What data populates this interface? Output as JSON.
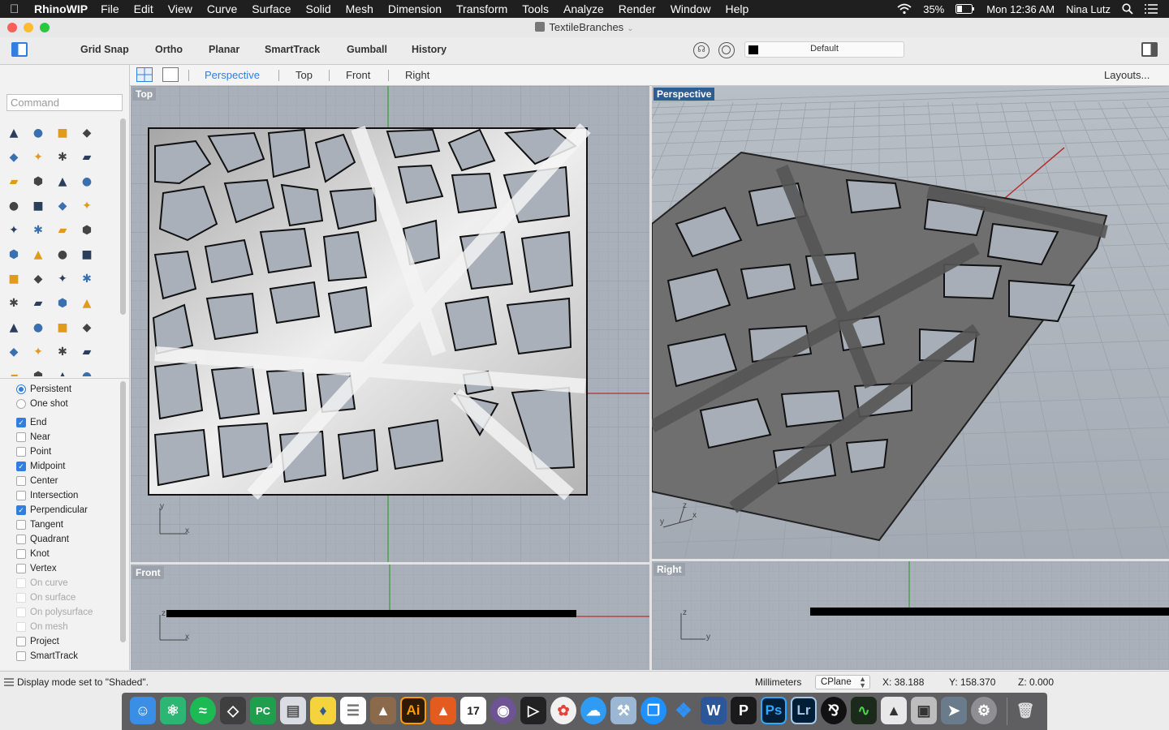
{
  "menubar": {
    "app_name": "RhinoWIP",
    "items": [
      "File",
      "Edit",
      "View",
      "Curve",
      "Surface",
      "Solid",
      "Mesh",
      "Dimension",
      "Transform",
      "Tools",
      "Analyze",
      "Render",
      "Window",
      "Help"
    ],
    "battery": "35%",
    "clock": "Mon 12:36 AM",
    "user": "Nina Lutz"
  },
  "window": {
    "title": "TextileBranches"
  },
  "toolbar": {
    "grid_snap": "Grid Snap",
    "ortho": "Ortho",
    "planar": "Planar",
    "smarttrack": "SmartTrack",
    "gumball": "Gumball",
    "history": "History",
    "layer": "Default"
  },
  "viewport_tabs": {
    "perspective": "Perspective",
    "top": "Top",
    "front": "Front",
    "right": "Right",
    "layouts": "Layouts..."
  },
  "command": {
    "placeholder": "Command"
  },
  "osnap": {
    "persistent": "Persistent",
    "one_shot": "One shot",
    "items": [
      {
        "label": "End",
        "checked": true
      },
      {
        "label": "Near",
        "checked": false
      },
      {
        "label": "Point",
        "checked": false
      },
      {
        "label": "Midpoint",
        "checked": true
      },
      {
        "label": "Center",
        "checked": false
      },
      {
        "label": "Intersection",
        "checked": false
      },
      {
        "label": "Perpendicular",
        "checked": true
      },
      {
        "label": "Tangent",
        "checked": false
      },
      {
        "label": "Quadrant",
        "checked": false
      },
      {
        "label": "Knot",
        "checked": false
      },
      {
        "label": "Vertex",
        "checked": false
      },
      {
        "label": "On curve",
        "checked": false,
        "disabled": true
      },
      {
        "label": "On surface",
        "checked": false,
        "disabled": true
      },
      {
        "label": "On polysurface",
        "checked": false,
        "disabled": true
      },
      {
        "label": "On mesh",
        "checked": false,
        "disabled": true
      },
      {
        "label": "Project",
        "checked": false
      },
      {
        "label": "SmartTrack",
        "checked": false
      }
    ]
  },
  "viewports": {
    "top": "Top",
    "perspective": "Perspective",
    "front": "Front",
    "right": "Right"
  },
  "axes": {
    "x": "x",
    "y": "y",
    "z": "z"
  },
  "status": {
    "message": "Display mode set to \"Shaded\".",
    "units": "Millimeters",
    "cplane": "CPlane",
    "x": "X: 38.188",
    "y": "Y: 158.370",
    "z": "Z: 0.000"
  },
  "dock": {
    "illustrator": "Ai",
    "photoshop": "Ps",
    "lightroom": "Lr",
    "calendar_day": "17",
    "pycharm": "PC"
  }
}
